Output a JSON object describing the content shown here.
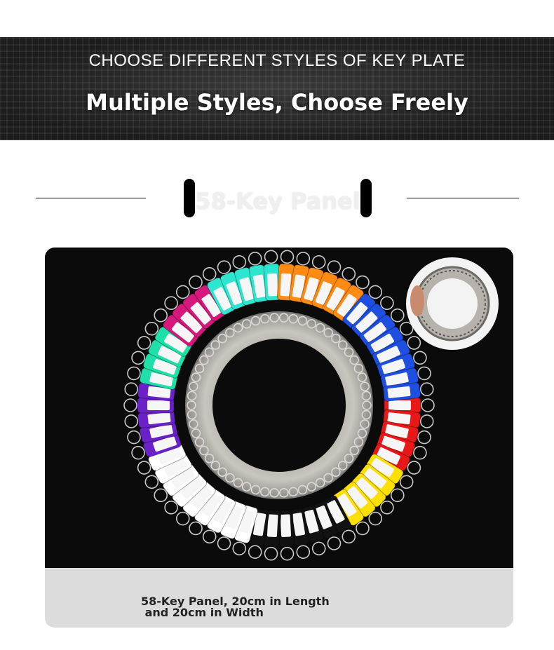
{
  "banner": {
    "subtitle": "CHOOSE DIFFERENT STYLES OF KEY PLATE",
    "title": "Multiple Styles, Choose Freely"
  },
  "section": {
    "heading": "58-Key Panel"
  },
  "product": {
    "caption_line1": "58-Key Panel, 20cm in Length",
    "caption_line2": " and 20cm in Width",
    "tag_colors": [
      "#1ee0a8",
      "#d6187c",
      "#2ee6d0",
      "#ff8a14",
      "#1e4fe0",
      "#e81818",
      "#ffe000",
      "#111111",
      "#ffffff",
      "#6a22c8"
    ]
  }
}
